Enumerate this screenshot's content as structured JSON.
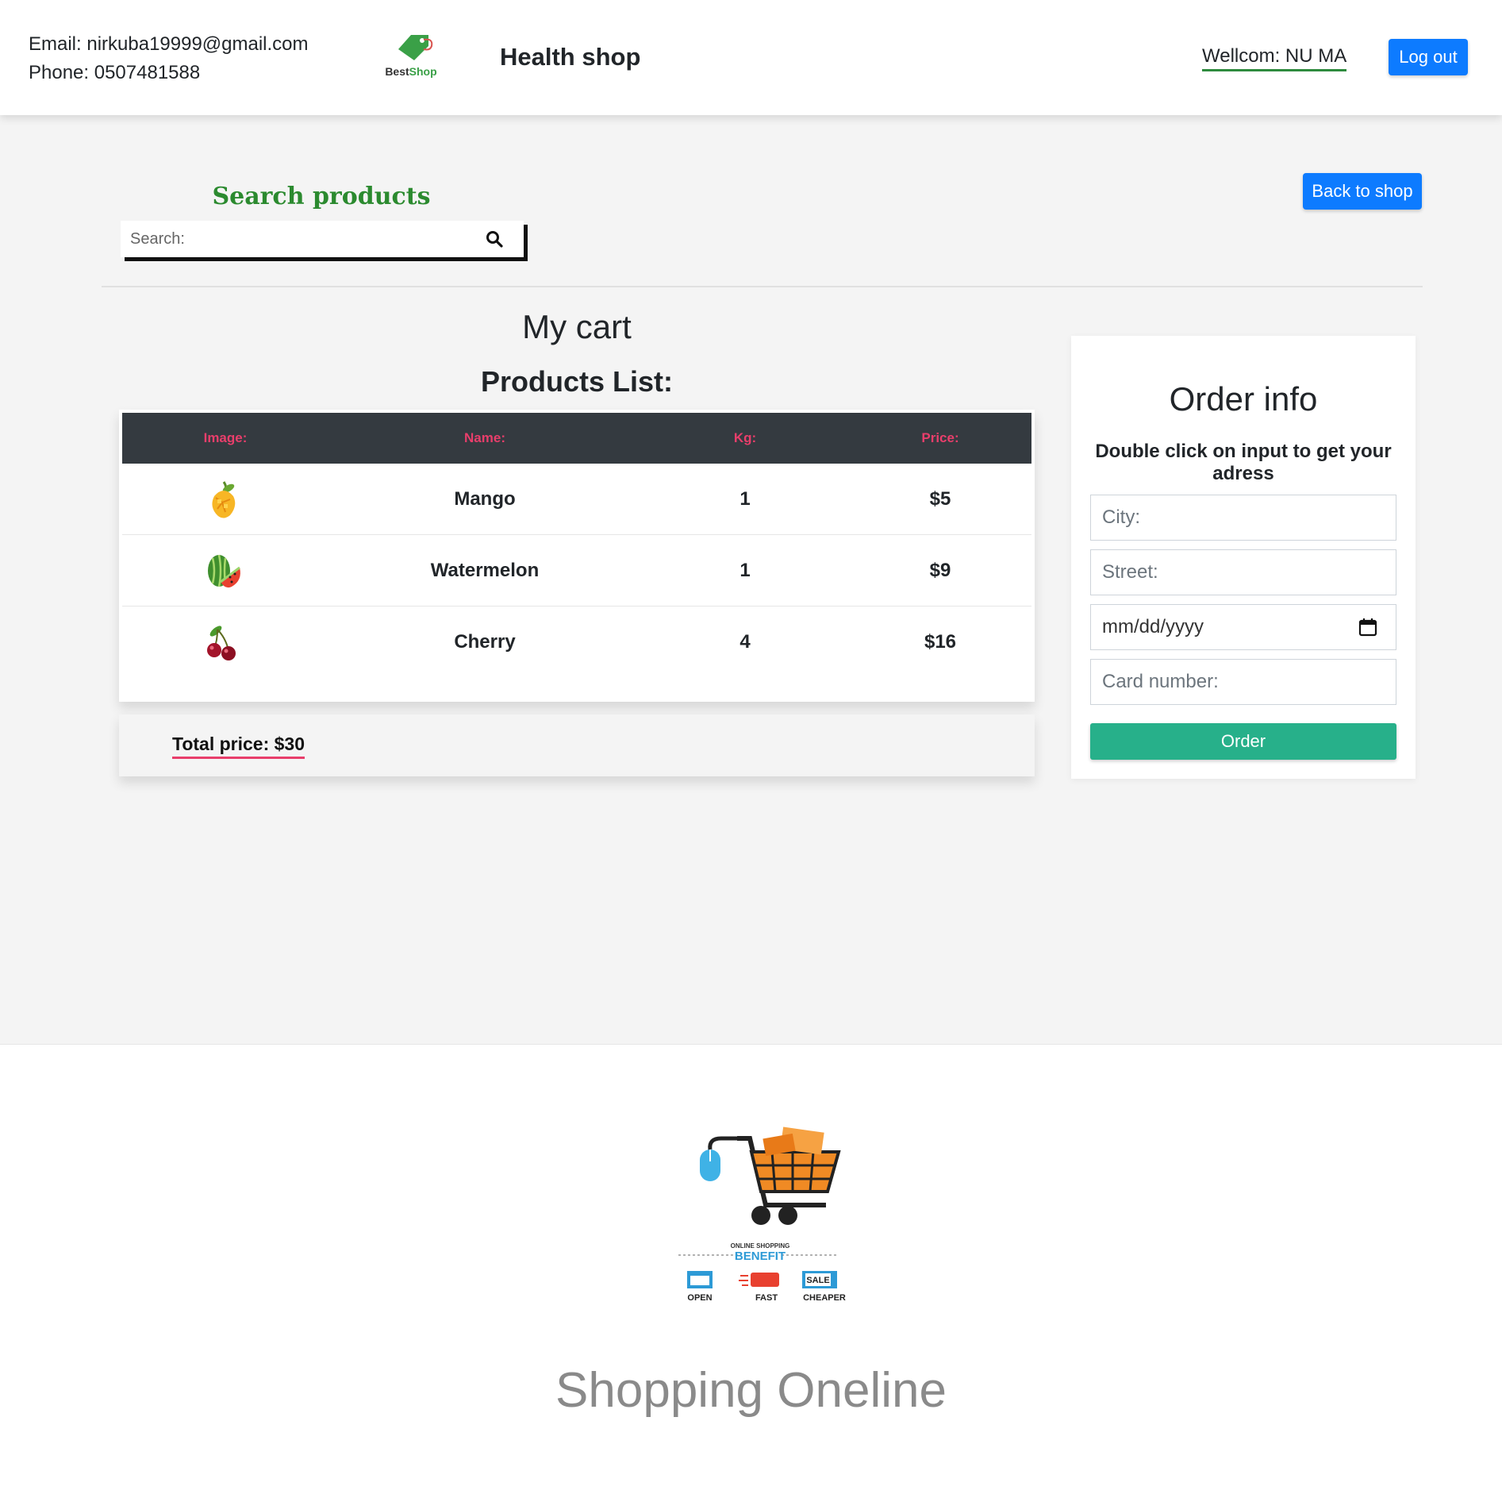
{
  "header": {
    "email": "Email: nirkuba19999@gmail.com",
    "phone": "Phone: 0507481588",
    "logo_text_best": "Best",
    "logo_text_shop": "Shop",
    "title": "Health shop",
    "welcome": "Wellcom: NU MA",
    "logout_label": "Log out"
  },
  "search": {
    "title": "Search products",
    "placeholder": "Search:"
  },
  "back_label": "Back to shop",
  "cart": {
    "title": "My cart",
    "list_title": "Products List:",
    "columns": [
      "Image:",
      "Name:",
      "Kg:",
      "Price:"
    ],
    "rows": [
      {
        "image": "mango-icon",
        "name": "Mango",
        "kg": "1",
        "price": "$5"
      },
      {
        "image": "watermelon-icon",
        "name": "Watermelon",
        "kg": "1",
        "price": "$9"
      },
      {
        "image": "cherry-icon",
        "name": "Cherry",
        "kg": "4",
        "price": "$16"
      }
    ],
    "total": "Total price: $30"
  },
  "order": {
    "title": "Order info",
    "hint": "Double click on input to get your adress",
    "city_placeholder": "City:",
    "street_placeholder": "Street:",
    "date_value": "mm/dd/yyyy",
    "card_placeholder": "Card number:",
    "order_label": "Order"
  },
  "footer": {
    "art_caption_small": "ONLINE SHOPPING",
    "art_caption": "BENEFIT",
    "badges": [
      "OPEN",
      "FAST",
      "CHEAPER"
    ],
    "title": "Shopping Oneline"
  },
  "colors": {
    "primary": "#0d7bff",
    "green_title": "#2b8a2f",
    "pink_accent": "#e83e6b",
    "order_button": "#27b08a",
    "table_header": "#343a40"
  }
}
